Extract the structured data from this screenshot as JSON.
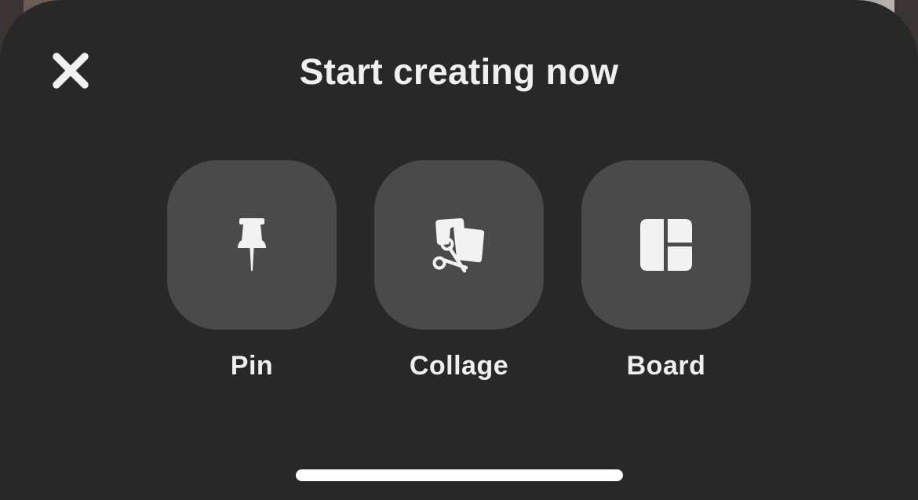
{
  "sheet": {
    "title": "Start creating now"
  },
  "close": {
    "icon": "close-icon"
  },
  "options": [
    {
      "label": "Pin",
      "icon": "pushpin-icon"
    },
    {
      "label": "Collage",
      "icon": "collage-scissors-icon"
    },
    {
      "label": "Board",
      "icon": "board-layout-icon"
    }
  ],
  "colors": {
    "sheet_background": "#282828",
    "tile_background": "#4a4a4a",
    "text": "#efefef",
    "icon": "#f2f2f2"
  }
}
